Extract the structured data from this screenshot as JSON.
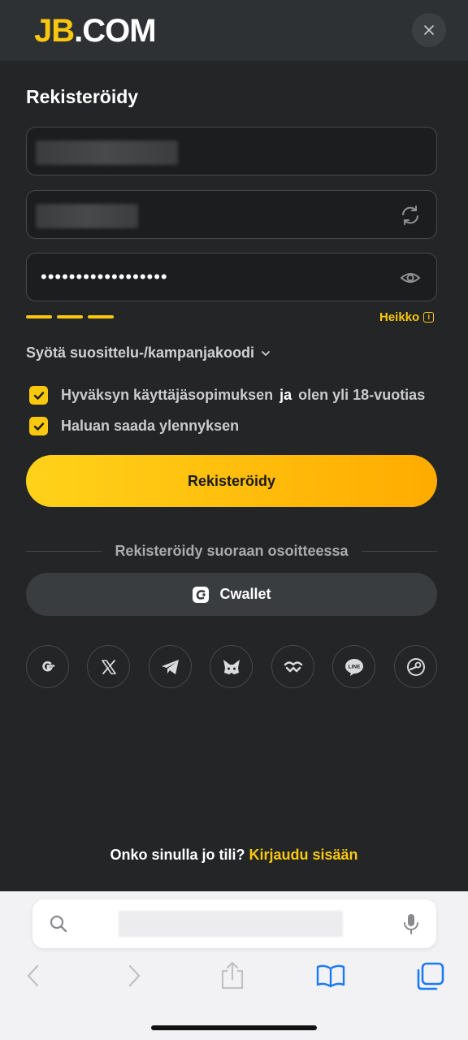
{
  "header": {
    "logo_jb": "JB",
    "logo_dom": ".COM",
    "close_icon": "close-icon"
  },
  "form": {
    "title": "Rekisteröidy",
    "password_mask": "••••••••••••••••••",
    "password_strength_label": "Heikko",
    "promo_label": "Syötä suosittelu-/kampanjakoodi",
    "terms_pre": "Hyväksyn käyttäjäsopimuksen",
    "terms_ja": "ja",
    "terms_post": "olen yli 18-vuotias",
    "promotions_label": "Haluan saada ylennyksen",
    "submit_label": "Rekisteröidy"
  },
  "alt_signup": {
    "divider_text": "Rekisteröidy suoraan osoitteessa",
    "cwallet_label": "Cwallet",
    "social_icons": [
      "google-icon",
      "x-icon",
      "telegram-icon",
      "metamask-icon",
      "walletconnect-icon",
      "line-icon",
      "steam-icon"
    ]
  },
  "footer": {
    "have_account": "Onko sinulla jo tili?",
    "login_link": "Kirjaudu sisään"
  },
  "colors": {
    "accent": "#f9c80e",
    "background": "#232526",
    "surface": "#2e3133"
  }
}
